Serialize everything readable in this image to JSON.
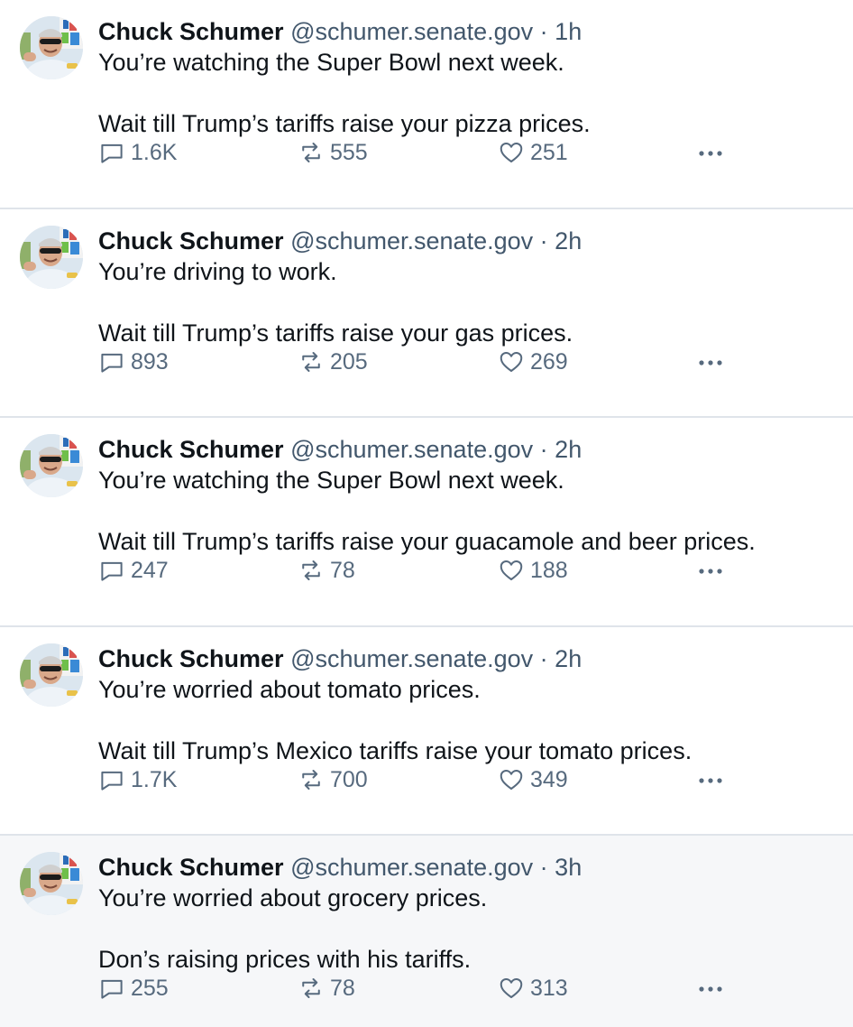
{
  "posts": [
    {
      "name": "Chuck Schumer",
      "handle": "@schumer.senate.gov",
      "separator": "·",
      "time": "1h",
      "line1": "You’re watching the Super Bowl next week.",
      "line2": "Wait till Trump’s tariffs raise your pizza prices.",
      "replies": "1.6K",
      "reposts": "555",
      "likes": "251"
    },
    {
      "name": "Chuck Schumer",
      "handle": "@schumer.senate.gov",
      "separator": "·",
      "time": "2h",
      "line1": "You’re driving to work.",
      "line2": "Wait till Trump’s tariffs raise your gas prices.",
      "replies": "893",
      "reposts": "205",
      "likes": "269"
    },
    {
      "name": "Chuck Schumer",
      "handle": "@schumer.senate.gov",
      "separator": "·",
      "time": "2h",
      "line1": "You’re watching the Super Bowl next week.",
      "line2": "Wait till Trump’s tariffs raise your guacamole and beer prices.",
      "replies": "247",
      "reposts": "78",
      "likes": "188"
    },
    {
      "name": "Chuck Schumer",
      "handle": "@schumer.senate.gov",
      "separator": "·",
      "time": "2h",
      "line1": "You’re worried about tomato prices.",
      "line2": "Wait till Trump’s Mexico tariffs raise your tomato prices.",
      "replies": "1.7K",
      "reposts": "700",
      "likes": "349"
    },
    {
      "name": "Chuck Schumer",
      "handle": "@schumer.senate.gov",
      "separator": "·",
      "time": "3h",
      "line1": "You’re worried about grocery prices.",
      "line2": "Don’s raising prices with his tariffs.",
      "replies": "255",
      "reposts": "78",
      "likes": "313"
    }
  ],
  "icons": {
    "reply": "reply-bubble-icon",
    "repost": "repost-arrows-icon",
    "like": "heart-icon",
    "more": "more-dots-icon"
  },
  "colors": {
    "text": "#0f1419",
    "secondary": "#42576c",
    "action": "#576a7e",
    "divider": "#dfe4ea",
    "highlight_bg": "#f6f7f9"
  }
}
